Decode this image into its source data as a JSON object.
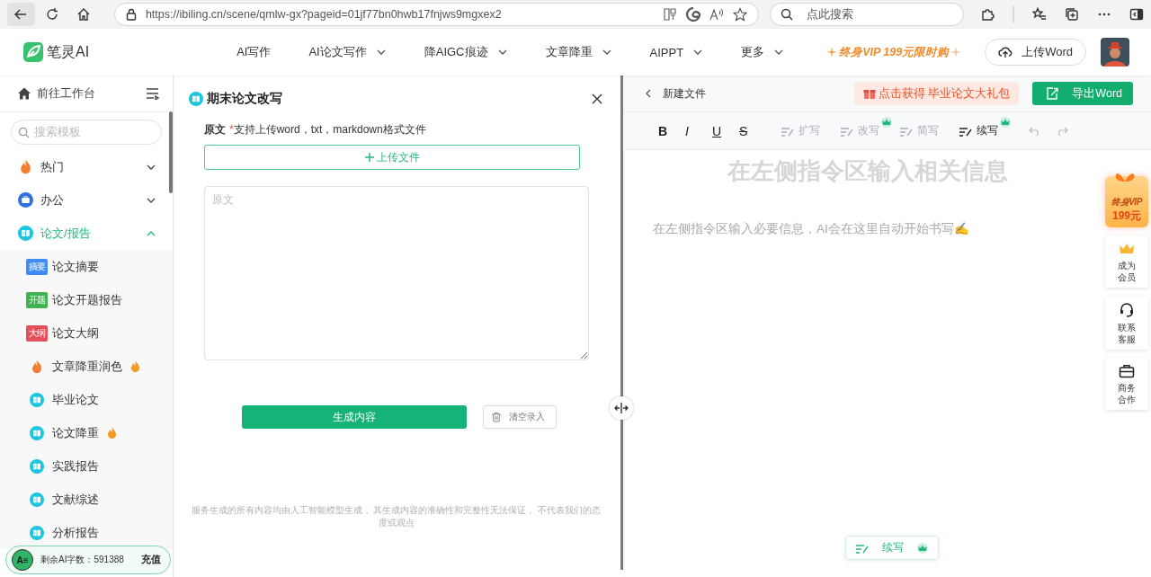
{
  "browser": {
    "url": "https://ibiling.cn/scene/qmlw-gx?pageid=01jf77bn0hwb17fnjws9mgxex2",
    "search_placeholder": "点此搜索"
  },
  "header": {
    "logo": "笔灵AI",
    "nav": [
      {
        "label": "AI写作",
        "dropdown": false
      },
      {
        "label": "AI论文写作",
        "dropdown": true
      },
      {
        "label": "降AIGC痕迹",
        "dropdown": true
      },
      {
        "label": "文章降重",
        "dropdown": true
      },
      {
        "label": "AIPPT",
        "dropdown": true
      },
      {
        "label": "更多",
        "dropdown": true
      }
    ],
    "promo": "终身VIP 199元限时购",
    "upload_button": "上传Word"
  },
  "sidebar": {
    "workbench": "前往工作台",
    "search_placeholder": "搜索模板",
    "categories": [
      {
        "label": "热门",
        "kind": "hot",
        "expanded": false
      },
      {
        "label": "办公",
        "kind": "office",
        "expanded": false
      },
      {
        "label": "论文/报告",
        "kind": "book",
        "expanded": true,
        "children": [
          {
            "label": "论文摘要",
            "kind": "tag",
            "tag": "摘要",
            "color": "#3f8cf7",
            "hot": false
          },
          {
            "label": "论文开题报告",
            "kind": "tag",
            "tag": "开题",
            "color": "#3fb34f",
            "hot": false
          },
          {
            "label": "论文大纲",
            "kind": "tag",
            "tag": "大纲",
            "color": "#e4505a",
            "hot": false
          },
          {
            "label": "文章降重润色",
            "kind": "hot",
            "hot": true
          },
          {
            "label": "毕业论文",
            "kind": "book",
            "hot": false
          },
          {
            "label": "论文降重",
            "kind": "book",
            "hot": true
          },
          {
            "label": "实践报告",
            "kind": "book",
            "hot": false
          },
          {
            "label": "文献综述",
            "kind": "book",
            "hot": false
          },
          {
            "label": "分析报告",
            "kind": "book",
            "hot": false
          }
        ]
      }
    ],
    "quota": {
      "avatar": "A≡",
      "label": "剩余AI字数：591388",
      "action": "充值"
    }
  },
  "form": {
    "title": "期末论文改写",
    "field_label": "原文",
    "required_mark": "*",
    "hint": "支持上传word，txt，markdown格式文件",
    "upload_button": "上传文件",
    "textarea_placeholder": "原文",
    "generate_button": "生成内容",
    "clear_button": "清空录入",
    "disclaimer": "服务生成的所有内容均由人工智能模型生成， 其生成内容的准确性和完整性无法保证， 不代表我们的态度或观点"
  },
  "editor": {
    "back_label": "新建文件",
    "gift_banner": "点击获得 毕业论文大礼包",
    "export_button": "导出Word",
    "format_tools": [
      {
        "label": "B",
        "kind": "bold"
      },
      {
        "label": "I",
        "kind": "italic"
      },
      {
        "label": "U",
        "kind": "underline"
      },
      {
        "label": "S",
        "kind": "strike"
      }
    ],
    "ai_tools": [
      {
        "label": "扩写",
        "premium": false,
        "enabled": false
      },
      {
        "label": "改写",
        "premium": true,
        "enabled": false
      },
      {
        "label": "简写",
        "premium": false,
        "enabled": false
      },
      {
        "label": "续写",
        "premium": true,
        "enabled": true
      }
    ],
    "heading": "在左侧指令区输入相关信息",
    "body": "在左侧指令区输入必要信息，AI会在这里自动开始书写✍️",
    "float_button": {
      "label": "续写",
      "premium": true
    }
  },
  "side_tools": {
    "vip": {
      "line1": "终身VIP",
      "line2": "199元"
    },
    "items": [
      {
        "label": "成为会员",
        "kind": "crown"
      },
      {
        "label": "联系客服",
        "kind": "headset"
      },
      {
        "label": "商务合作",
        "kind": "briefcase"
      }
    ]
  }
}
